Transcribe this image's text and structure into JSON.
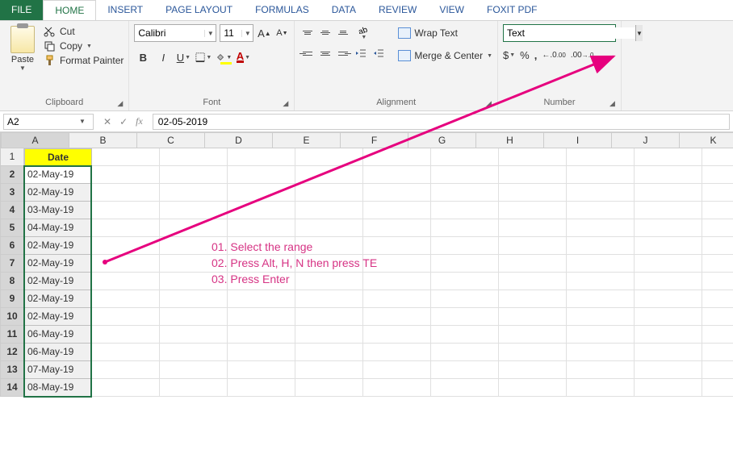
{
  "tabs": {
    "file": "FILE",
    "home": "HOME",
    "insert": "INSERT",
    "page_layout": "PAGE LAYOUT",
    "formulas": "FORMULAS",
    "data": "DATA",
    "review": "REVIEW",
    "view": "VIEW",
    "foxit": "FOXIT PDF"
  },
  "ribbon": {
    "clipboard": {
      "paste": "Paste",
      "cut": "Cut",
      "copy": "Copy",
      "format_painter": "Format Painter",
      "label": "Clipboard"
    },
    "font": {
      "name": "Calibri",
      "size": "11",
      "bold": "B",
      "italic": "I",
      "underline": "U",
      "label": "Font"
    },
    "alignment": {
      "wrap": "Wrap Text",
      "merge": "Merge & Center",
      "label": "Alignment"
    },
    "number": {
      "format": "Text",
      "currency": "$",
      "percent": "%",
      "comma": ",",
      "inc_dec": ".0",
      "label": "Number"
    }
  },
  "formula_bar": {
    "name_box": "A2",
    "formula": "02-05-2019"
  },
  "columns": [
    "A",
    "B",
    "C",
    "D",
    "E",
    "F",
    "G",
    "H",
    "I",
    "J",
    "K"
  ],
  "rows_shown": 14,
  "sheet": {
    "header": "Date",
    "colA": [
      "02-May-19",
      "02-May-19",
      "03-May-19",
      "04-May-19",
      "02-May-19",
      "02-May-19",
      "02-May-19",
      "02-May-19",
      "02-May-19",
      "06-May-19",
      "06-May-19",
      "07-May-19",
      "08-May-19"
    ]
  },
  "annotation": {
    "line1": "01. Select the range",
    "line2": "02. Press Alt, H, N then press TE",
    "line3": "03. Press Enter"
  }
}
